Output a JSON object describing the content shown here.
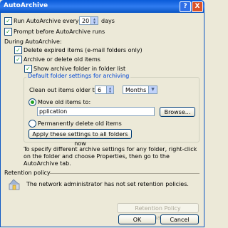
{
  "window": {
    "title": "AutoArchive",
    "help_glyph": "?",
    "close_glyph": "X"
  },
  "autoarchive": {
    "run_label_before": "Run AutoArchive every",
    "run_days_value": "20",
    "run_label_after": "days",
    "prompt_label": "Prompt before AutoArchive runs",
    "during_label": "During AutoArchive:",
    "delete_expired_label": "Delete expired items (e-mail folders only)",
    "archive_old_label": "Archive or delete old items",
    "show_folder_label": "Show archive folder in folder list"
  },
  "default_settings": {
    "group_title": "Default folder settings for archiving",
    "clean_out_label": "Clean out items older than",
    "age_value": "6",
    "age_unit": "Months",
    "move_old_label": "Move old items to:",
    "archive_path": "pplication Data\\Microsoft\\Outlook\\archive.pst",
    "browse_label": "Browse...",
    "permanently_delete_label": "Permanently delete old items",
    "apply_all_label": "Apply these settings to all folders now"
  },
  "info_text_lines": [
    "To specify different archive settings for any folder, right-click",
    "on the folder and choose Properties, then go to the",
    "AutoArchive tab."
  ],
  "retention": {
    "section_label": "Retention policy",
    "policy_text": "The network administrator has not set retention policies.",
    "info_button_label": "Retention Policy Information..."
  },
  "footer": {
    "ok_label": "OK",
    "cancel_label": "Cancel"
  },
  "checkbox_states": {
    "run_every": true,
    "prompt": true,
    "delete_expired": true,
    "archive_old": true,
    "show_folder": true
  },
  "selected_option": "move_old_items",
  "colors": {
    "title_bar": "#0a5bd8",
    "group_title": "#0046d5",
    "check_mark": "#21a121"
  }
}
